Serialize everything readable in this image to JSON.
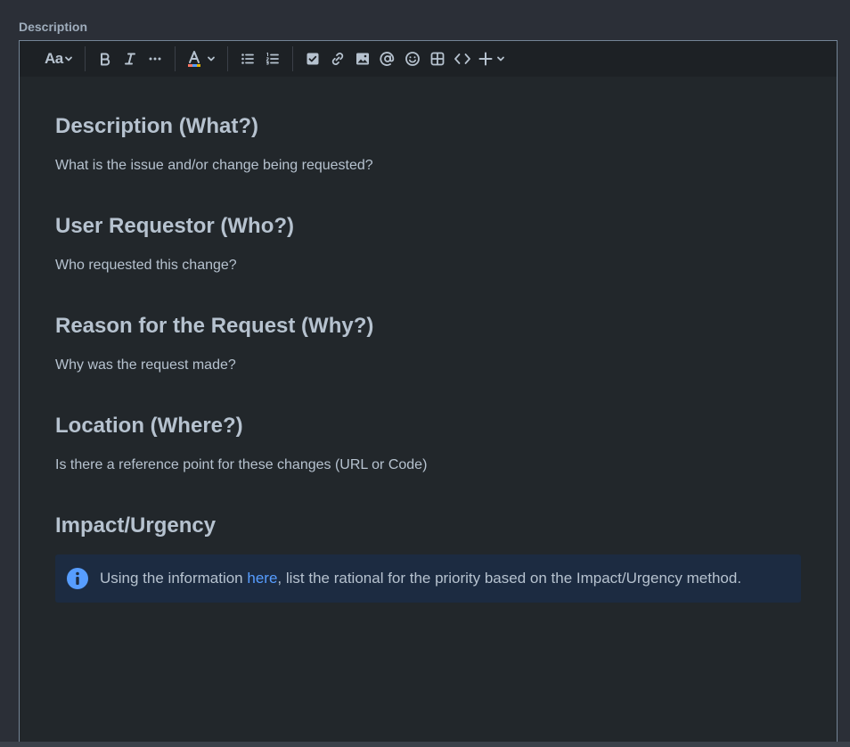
{
  "field": {
    "label": "Description"
  },
  "toolbar": {
    "text_style_label": "Aa",
    "icons": [
      "text-style-icon",
      "bold-icon",
      "italic-icon",
      "more-formatting-icon",
      "text-color-icon",
      "bullet-list-icon",
      "numbered-list-icon",
      "checkbox-icon",
      "link-icon",
      "image-icon",
      "mention-icon",
      "emoji-icon",
      "table-icon",
      "code-icon",
      "insert-plus-icon"
    ]
  },
  "sections": [
    {
      "heading": "Description (What?)",
      "body": "What is the issue and/or change being requested?"
    },
    {
      "heading": "User Requestor (Who?)",
      "body": "Who requested this change?"
    },
    {
      "heading": "Reason for the Request (Why?)",
      "body": "Why was the request made?"
    },
    {
      "heading": "Location (Where?)",
      "body": "Is there a reference point for these changes (URL or Code)"
    },
    {
      "heading": "Impact/Urgency"
    }
  ],
  "info_panel": {
    "prefix": "Using the information ",
    "link_text": "here",
    "suffix": ", list the rational for the priority based on the Impact/Urgency method."
  },
  "colors": {
    "background": "#22272b",
    "toolbar": "#1d2125",
    "panel": "#1c2b41",
    "link": "#579dff",
    "info_icon": "#579dff"
  }
}
